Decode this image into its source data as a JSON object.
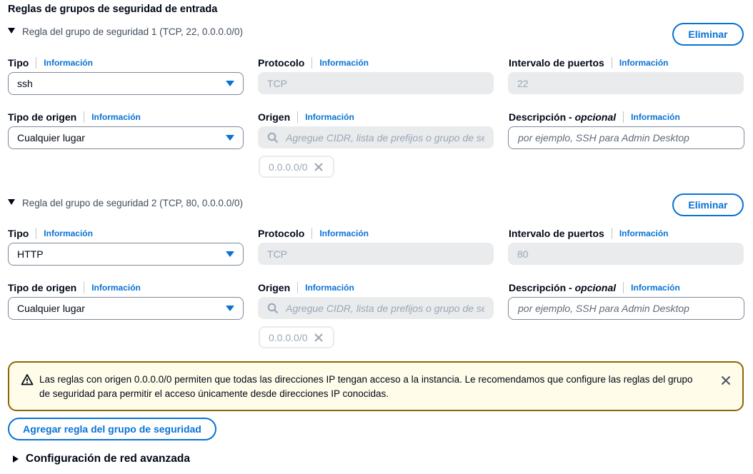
{
  "section_title": "Reglas de grupos de seguridad de entrada",
  "info_label": "Información",
  "remove_label": "Eliminar",
  "labels": {
    "type": "Tipo",
    "protocol": "Protocolo",
    "port_range": "Intervalo de puertos",
    "source_type": "Tipo de origen",
    "source": "Origen",
    "description": "Descripción - ",
    "description_optional": "opcional"
  },
  "rules": [
    {
      "header": "Regla del grupo de seguridad 1 (TCP, 22, 0.0.0.0/0)",
      "type": "ssh",
      "protocol": "TCP",
      "port_range": "22",
      "source_type": "Cualquier lugar",
      "source_placeholder": "Agregue CIDR, lista de prefijos o grupo de seg",
      "source_token": "0.0.0.0/0",
      "description_placeholder": "por ejemplo, SSH para Admin Desktop"
    },
    {
      "header": "Regla del grupo de seguridad 2 (TCP, 80, 0.0.0.0/0)",
      "type": "HTTP",
      "protocol": "TCP",
      "port_range": "80",
      "source_type": "Cualquier lugar",
      "source_placeholder": "Agregue CIDR, lista de prefijos o grupo de seg",
      "source_token": "0.0.0.0/0",
      "description_placeholder": "por ejemplo, SSH para Admin Desktop"
    }
  ],
  "alert": {
    "text": "Las reglas con origen 0.0.0.0/0 permiten que todas las direcciones IP tengan acceso a la instancia. Le recomendamos que configure las reglas del grupo de seguridad para permitir el acceso únicamente desde direcciones IP conocidas."
  },
  "add_rule_label": "Agregar regla del grupo de seguridad",
  "advanced_label": "Configuración de red avanzada",
  "colors": {
    "link": "#0972d3",
    "warning_border": "#8d6605",
    "warning_bg": "#fffce9"
  }
}
